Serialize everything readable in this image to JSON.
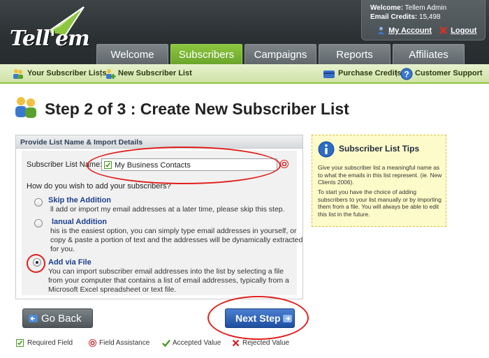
{
  "brand": {
    "logo_text": "Tell'em"
  },
  "account": {
    "welcome_label": "Welcome:",
    "welcome_value": "Tellem Admin",
    "credits_label": "Email Credits:",
    "credits_value": "15,498",
    "my_account": "My Account",
    "logout": "Logout"
  },
  "tabs": [
    {
      "label": "Welcome"
    },
    {
      "label": "Subscribers"
    },
    {
      "label": "Campaigns"
    },
    {
      "label": "Reports"
    },
    {
      "label": "Affiliates"
    }
  ],
  "active_tab": "Subscribers",
  "subnav": {
    "your_lists": "Your Subscriber Lists",
    "sep": "|",
    "new_list": "New Subscriber List",
    "purchase": "Purchase Credits",
    "support": "Customer Support"
  },
  "page": {
    "title": "Step 2 of 3 : Create New Subscriber List"
  },
  "form": {
    "panel_title": "Provide List Name & Import Details",
    "list_name_label": "Subscriber List Name:",
    "list_name_value": "My Business Contacts",
    "question": "How do you wish to add your subscribers?",
    "options": [
      {
        "title": "Skip the Addition",
        "desc": "ll add or import my email addresses at a later time, please skip this step.",
        "checked": false
      },
      {
        "title": "lanual Addition",
        "desc": "his is the easiest option, you can simply type email addresses in yourself, or copy & paste a portion of text and the addresses will be dynamically extracted for you.",
        "checked": false
      },
      {
        "title": "Add via File",
        "desc": "You can import subscriber email addresses into the list by selecting a file from your computer that contains a list of email addresses, typically from a Microsoft Excel spreadsheet or text file.",
        "checked": true
      }
    ]
  },
  "buttons": {
    "back": "Go Back",
    "next": "Next Step"
  },
  "legend": {
    "required": "Required Field",
    "assistance": "Field Assistance",
    "accepted": "Accepted Value",
    "rejected": "Rejected Value"
  },
  "tips": {
    "title": "Subscriber List Tips",
    "para1": "Give your subscriber list a meaningful name as to what the emails in this list represent. (ie. New Clients 2006).",
    "para2": "To start you have the choice of adding subscribers to your list manually or by importing them from a file. You will always be able to edit this list in the future."
  },
  "colors": {
    "header": "#2b3133",
    "accent_green": "#8dc63f",
    "link_blue": "#1d3f8f",
    "annotation_red": "#e0201d",
    "tips_bg": "#fdfbc9"
  }
}
